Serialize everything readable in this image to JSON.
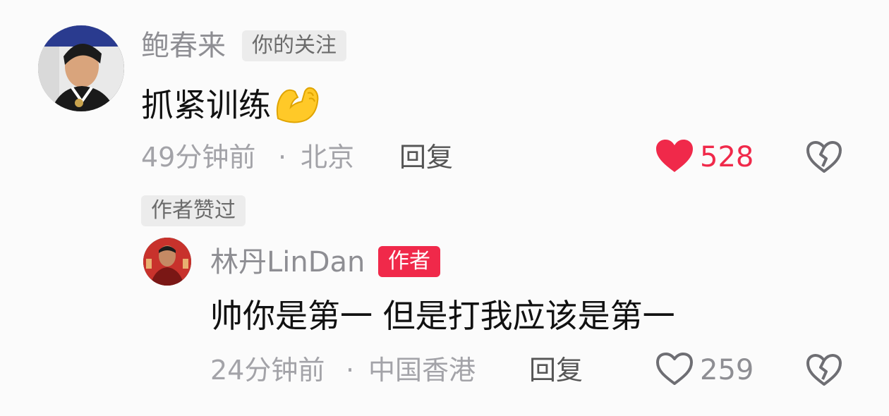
{
  "comment1": {
    "username": "鲍春来",
    "badge": "你的关注",
    "text": "抓紧训练",
    "emoji": "flexed-biceps-emoji",
    "time": "49分钟前",
    "sep": "·",
    "location": "北京",
    "reply": "回复",
    "likes": "528",
    "author_liked": "作者赞过"
  },
  "reply1": {
    "username": "林丹LinDan",
    "badge": "作者",
    "text": "帅你是第一 但是打我应该是第一",
    "time": "24分钟前",
    "sep": "·",
    "location": "中国香港",
    "reply": "回复",
    "likes": "259"
  },
  "colors": {
    "accent_red": "#f0294a",
    "muted": "#a3a3a8"
  },
  "icons": [
    "heart-filled-icon",
    "heart-outline-icon",
    "broken-heart-icon"
  ]
}
